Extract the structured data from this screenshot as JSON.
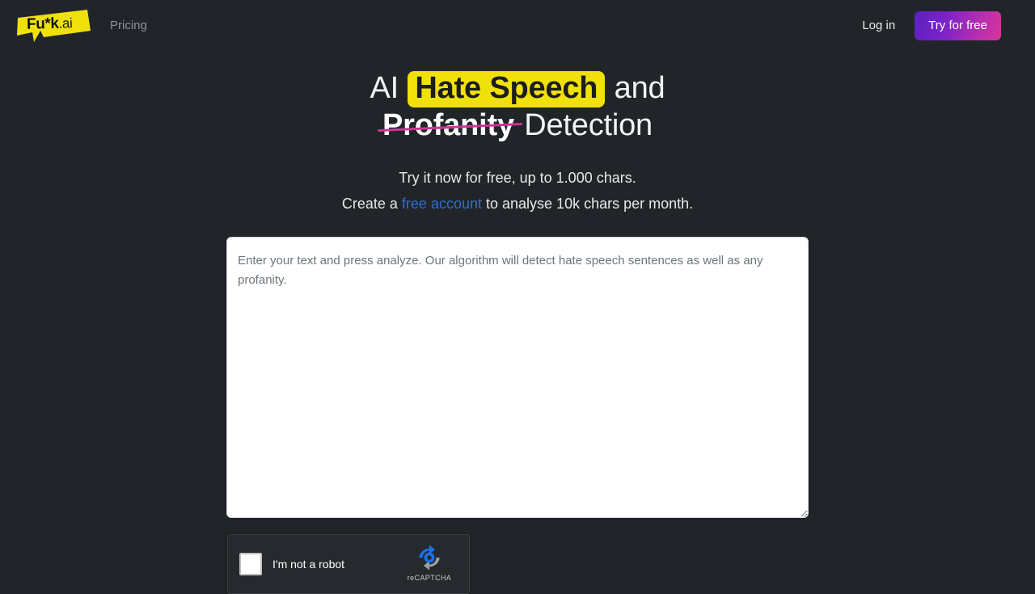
{
  "theme": {
    "background": "#212529",
    "accent_yellow": "#f0e10b",
    "accent_magenta": "#cf3396",
    "accent_purple": "#5d21bf",
    "link_blue": "#2f6fd0",
    "muted_text": "#8d9499"
  },
  "header": {
    "logo": {
      "name": "Fu*k",
      "tld": ".ai",
      "icon": "logo-banner-shape"
    },
    "nav": [
      {
        "label": "Pricing"
      }
    ],
    "login_label": "Log in",
    "cta_label": "Try for free"
  },
  "hero": {
    "headline": {
      "part1": "AI",
      "highlight": "Hate Speech",
      "part2": "and",
      "struck": "Profanity",
      "part3": "Detection"
    },
    "subtitle": {
      "line1": "Try it now for free, up to 1.000 chars.",
      "line2_before": "Create a",
      "line2_link": "free account",
      "line2_after": "to analyse 10k chars per month."
    }
  },
  "editor": {
    "placeholder": "Enter your text and press analyze. Our algorithm will detect hate speech sentences as well as any profanity.",
    "value": ""
  },
  "recaptcha": {
    "label": "I'm not a robot",
    "brand": "reCAPTCHA",
    "checked": false,
    "icon": "recaptcha-refresh-icon"
  }
}
